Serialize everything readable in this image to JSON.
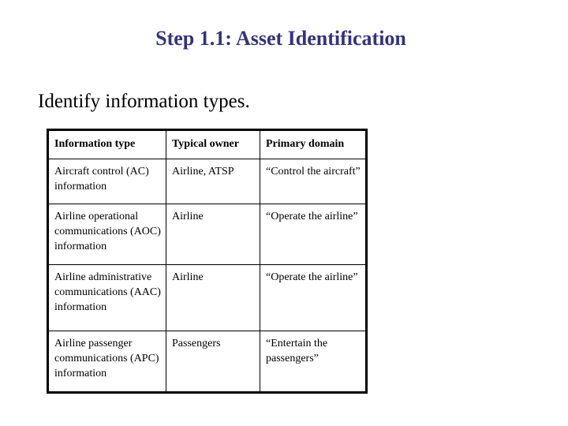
{
  "slide": {
    "title": "Step 1.1: Asset Identification",
    "subtitle": "Identify information types."
  },
  "table": {
    "headers": [
      "Information type",
      "Typical owner",
      "Primary domain"
    ],
    "rows": [
      {
        "information_type": "Aircraft control (AC) information",
        "typical_owner": "Airline, ATSP",
        "primary_domain": "“Control the aircraft”"
      },
      {
        "information_type": "Airline operational communications (AOC) information",
        "typical_owner": "Airline",
        "primary_domain": "“Operate the airline”"
      },
      {
        "information_type": "Airline administrative communications (AAC) information",
        "typical_owner": "Airline",
        "primary_domain": "“Operate the airline”"
      },
      {
        "information_type": "Airline passenger communications (APC) information",
        "typical_owner": "Passengers",
        "primary_domain": "“Entertain the passengers”"
      }
    ]
  },
  "colors": {
    "title": "#333380",
    "text": "#000000",
    "background": "#ffffff"
  }
}
